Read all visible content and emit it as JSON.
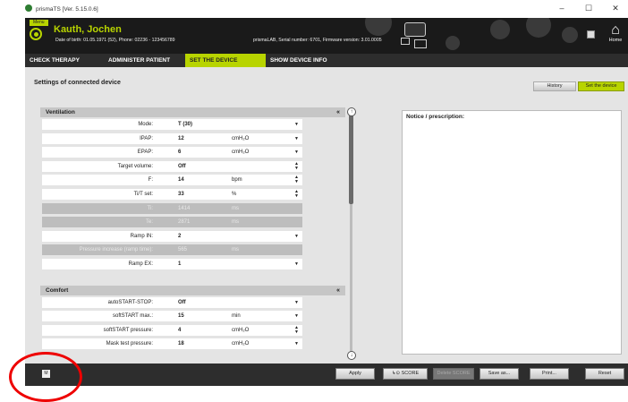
{
  "window": {
    "title": "prismaTS [Ver. 5.15.0.6]",
    "controls": [
      "–",
      "☐",
      "✕"
    ]
  },
  "header": {
    "menu_label": "Menu",
    "patient_name": "Kauth, Jochen",
    "patient_info": "Date of birth: 01.05.1971 (52),  Phone: 02236 - 123456789",
    "device_info": "prismaLAB,  Serial number: 6701,  Firmware version: 3.01.0005",
    "home_label": "Home"
  },
  "tabs": [
    {
      "label": "CHECK THERAPY",
      "active": false
    },
    {
      "label": "ADMINISTER PATIENT",
      "active": false
    },
    {
      "label": "SET THE DEVICE",
      "active": true
    },
    {
      "label": "SHOW DEVICE INFO",
      "active": false
    }
  ],
  "main": {
    "section_title": "Settings of connected device",
    "history_label": "History",
    "set_device_label": "Set the device",
    "ventilation": {
      "title": "Ventilation",
      "rows": [
        {
          "label": "Mode:",
          "value": "T (30)",
          "unit": "",
          "control": "dropdown",
          "disabled": false
        },
        {
          "label": "IPAP:",
          "value": "12",
          "unit": "cmH₂O",
          "control": "dropdown",
          "disabled": false
        },
        {
          "label": "EPAP:",
          "value": "6",
          "unit": "cmH₂O",
          "control": "dropdown",
          "disabled": false
        },
        {
          "label": "Target volume:",
          "value": "Off",
          "unit": "",
          "control": "stepper",
          "disabled": false
        },
        {
          "label": "F:",
          "value": "14",
          "unit": "bpm",
          "control": "stepper",
          "disabled": false
        },
        {
          "label": "Ti/T set:",
          "value": "33",
          "unit": "%",
          "control": "stepper",
          "disabled": false
        },
        {
          "label": "Ti:",
          "value": "1414",
          "unit": "ms",
          "control": "",
          "disabled": true
        },
        {
          "label": "Te:",
          "value": "2871",
          "unit": "ms",
          "control": "",
          "disabled": true
        },
        {
          "label": "Ramp IN:",
          "value": "2",
          "unit": "",
          "control": "dropdown",
          "disabled": false
        },
        {
          "label": "Pressure increase (ramp time):",
          "value": "565",
          "unit": "ms",
          "control": "",
          "disabled": true
        },
        {
          "label": "Ramp EX:",
          "value": "1",
          "unit": "",
          "control": "dropdown",
          "disabled": false
        }
      ]
    },
    "comfort": {
      "title": "Comfort",
      "rows": [
        {
          "label": "autoSTART-STOP:",
          "value": "Off",
          "unit": "",
          "control": "dropdown",
          "disabled": false
        },
        {
          "label": "softSTART max.:",
          "value": "15",
          "unit": "min",
          "control": "dropdown",
          "disabled": false
        },
        {
          "label": "softSTART pressure:",
          "value": "4",
          "unit": "cmH₂O",
          "control": "stepper",
          "disabled": false
        },
        {
          "label": "Mask test pressure:",
          "value": "18",
          "unit": "cmH₂O",
          "control": "dropdown",
          "disabled": false
        }
      ]
    },
    "notice_label": "Notice / prescription:"
  },
  "bottombar": {
    "apply": "Apply",
    "score": "SCORE",
    "delete_score": "Delete SCORE",
    "save_as": "Save as...",
    "print": "Print...",
    "reset": "Reset",
    "m_label": "M"
  }
}
